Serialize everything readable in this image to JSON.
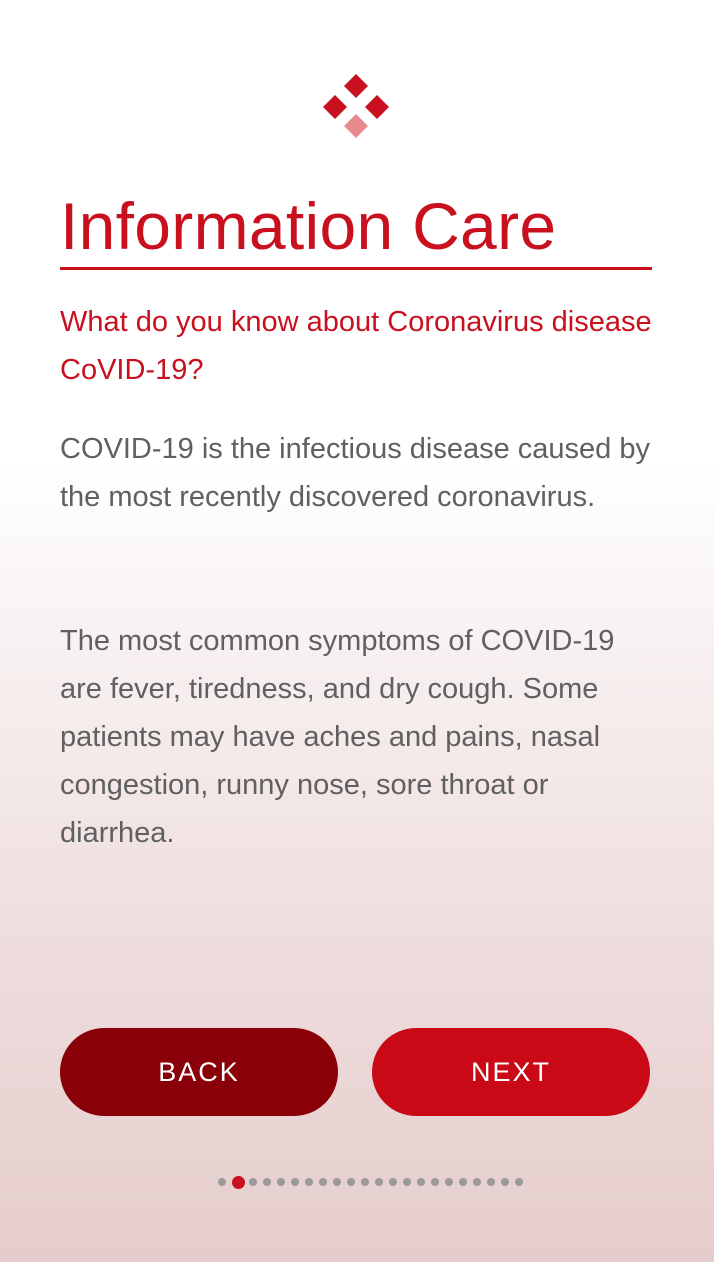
{
  "app": {
    "logo_icon": "diamond-cluster-logo-icon",
    "accent_color": "#c8101e",
    "accent_light": "#e68a8f",
    "dark_accent": "#8a0009"
  },
  "header": {
    "title": "Information Care"
  },
  "content": {
    "question": "What do you know about Coronavirus disease CoVID-19?",
    "paragraph_1": "COVID-19 is the infectious disease caused by the most recently discovered coronavirus.",
    "paragraph_2": "The most common symptoms of COVID-19 are fever, tiredness, and dry cough. Some patients may have aches and pains, nasal congestion, runny nose, sore throat or diarrhea."
  },
  "buttons": {
    "back_label": "BACK",
    "next_label": "NEXT"
  },
  "pager": {
    "total_pages": 22,
    "current_page": 2
  }
}
